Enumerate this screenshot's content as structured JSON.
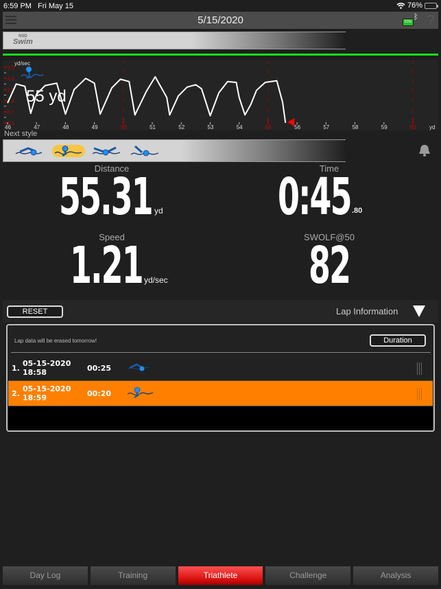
{
  "status_bar": {
    "time": "6:59 PM",
    "date": "Fri May 15",
    "battery_percent": "76%",
    "battery_level": 0.76
  },
  "nav": {
    "title": "5/15/2020",
    "device_battery": "51%",
    "device_battery_level": 0.51,
    "help": "?"
  },
  "brand": {
    "line1": "NSD",
    "line2": "Swim"
  },
  "distance_progress": 1.0,
  "chart": {
    "y_unit": "yd/sec",
    "x_unit": "yd",
    "current_distance_label": "55 yd",
    "colors": {
      "line": "#ffffff",
      "axis_red": "#cc0000",
      "marker": "#ff0000"
    }
  },
  "chart_data": {
    "type": "line",
    "title": "",
    "xlabel": "yd",
    "ylabel": "yd/sec",
    "xlim": [
      46,
      60
    ],
    "ylim": [
      0,
      3.5
    ],
    "x_ticks": [
      "46",
      "47",
      "48",
      "49",
      "50",
      "51",
      "52",
      "53",
      "54",
      "55",
      "56",
      "57",
      "58",
      "59",
      "60"
    ],
    "x_ticks_highlight": [
      "50",
      "55",
      "60"
    ],
    "y_ticks": [
      "0.0",
      "0.7",
      "1.4",
      "2.1",
      "2.8",
      "3.5"
    ],
    "grid": false,
    "current_marker_x": 55.6,
    "series": [
      {
        "name": "speed",
        "x": [
          46.0,
          46.3,
          46.6,
          46.8,
          47.0,
          47.3,
          47.7,
          48.0,
          48.3,
          48.7,
          49.0,
          49.2,
          49.6,
          49.9,
          50.2,
          50.4,
          50.8,
          51.1,
          51.5,
          51.6,
          51.9,
          52.2,
          52.5,
          52.7,
          53.0,
          53.3,
          53.6,
          53.9,
          54.0,
          54.2,
          54.4,
          54.6,
          54.9,
          55.3,
          55.5,
          55.6
        ],
        "y": [
          1.25,
          2.45,
          2.3,
          0.6,
          1.8,
          2.35,
          2.5,
          0.55,
          2.1,
          2.8,
          2.5,
          0.55,
          2.2,
          2.75,
          2.6,
          0.5,
          2.0,
          2.9,
          1.6,
          0.5,
          1.7,
          2.25,
          2.4,
          2.15,
          0.45,
          1.9,
          2.6,
          2.55,
          1.6,
          0.5,
          1.15,
          2.05,
          2.55,
          2.65,
          1.3,
          0.0
        ]
      }
    ]
  },
  "next_style": {
    "label": "Next style",
    "styles": [
      {
        "name": "freestyle",
        "selected": false
      },
      {
        "name": "breaststroke",
        "selected": true
      },
      {
        "name": "butterfly",
        "selected": false
      },
      {
        "name": "backstroke",
        "selected": false
      }
    ]
  },
  "metrics": {
    "distance": {
      "label": "Distance",
      "value": "55.31",
      "unit": "yd"
    },
    "time": {
      "label": "Time",
      "value": "0:45",
      "fraction": ".80"
    },
    "speed": {
      "label": "Speed",
      "value": "1.21",
      "unit": "yd/sec"
    },
    "swolf": {
      "label": "SWOLF@50",
      "value": "82"
    }
  },
  "laps": {
    "reset_label": "RESET",
    "title": "Lap Information",
    "note": "Lap data will be erased tomorrow!",
    "sort_label": "Duration",
    "rows": [
      {
        "index": "1.",
        "datetime": "05-15-2020 18:58",
        "duration": "00:25",
        "style": "freestyle",
        "selected": false
      },
      {
        "index": "2.",
        "datetime": "05-15-2020 18:59",
        "duration": "00:20",
        "style": "breaststroke",
        "selected": true
      }
    ],
    "highlight_color": "#ff8000"
  },
  "tabs": [
    {
      "label": "Day Log",
      "active": false
    },
    {
      "label": "Training",
      "active": false
    },
    {
      "label": "Triathlete",
      "active": true
    },
    {
      "label": "Challenge",
      "active": false
    },
    {
      "label": "Analysis",
      "active": false
    }
  ]
}
